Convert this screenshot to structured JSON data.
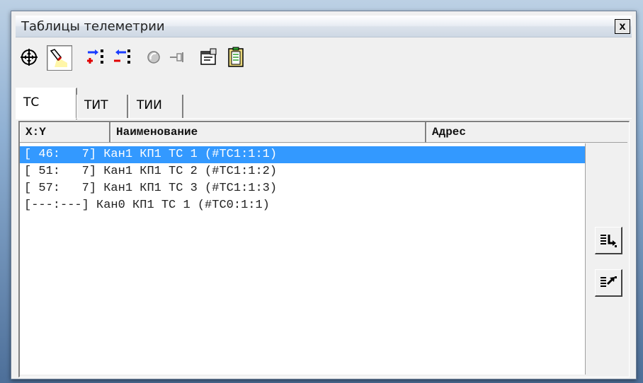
{
  "window": {
    "title": "Таблицы телеметрии",
    "close_label": "x"
  },
  "toolbar": {
    "buttons": [
      {
        "icon": "crosshair-icon",
        "pressed": false
      },
      {
        "icon": "flashlight-icon",
        "pressed": true
      },
      {
        "icon": "insert-rows-icon",
        "pressed": false
      },
      {
        "icon": "delete-rows-icon",
        "pressed": false
      },
      {
        "icon": "color-disk-icon",
        "pressed": false
      },
      {
        "icon": "pin-icon",
        "pressed": false
      },
      {
        "icon": "properties-icon",
        "pressed": false
      },
      {
        "icon": "clipboard-icon",
        "pressed": false
      }
    ]
  },
  "tabs": [
    {
      "label": "ТС",
      "active": true
    },
    {
      "label": "ТИТ",
      "active": false
    },
    {
      "label": "ТИИ",
      "active": false
    }
  ],
  "table": {
    "columns": [
      "X:Y",
      "Наименование",
      "Адрес"
    ],
    "rows": [
      {
        "xy": "[ 46:   7]",
        "name": "Кан1 КП1 ТС 1 (#ТС1:1:1)",
        "address": "",
        "selected": true
      },
      {
        "xy": "[ 51:   7]",
        "name": "Кан1 КП1 ТС 2 (#ТС1:1:2)",
        "address": "",
        "selected": false
      },
      {
        "xy": "[ 57:   7]",
        "name": "Кан1 КП1 ТС 3 (#ТС1:1:3)",
        "address": "",
        "selected": false
      },
      {
        "xy": "[---:---]",
        "name": "Кан0 КП1 ТС 1 (#ТС0:1:1)",
        "address": "",
        "selected": false
      }
    ]
  },
  "side_buttons": [
    {
      "icon": "import-list-icon"
    },
    {
      "icon": "export-list-icon"
    }
  ],
  "colors": {
    "selection": "#3399ff",
    "accent_red": "#e00000",
    "accent_blue": "#1a3cff"
  }
}
